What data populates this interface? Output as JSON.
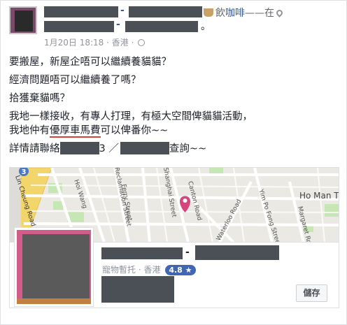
{
  "post": {
    "name_sep": "-",
    "feeling_prefix": "飲",
    "feeling_item": "咖啡",
    "feeling_at": "——在",
    "subtitle_sep": "-",
    "subtitle_end": "。",
    "timestamp": "1月20日 18:18",
    "location": "香港",
    "dot": "·",
    "body": {
      "line1": "要搬屋，新屋企唔可以繼續養貓貓？",
      "line2": "經濟問題唔可以繼續養了嗎？",
      "line3": "拾獲棄貓嗎？",
      "line4": "我地一樣接收，有專人打理，有極大空間俾貓貓活動，",
      "line5_a": "我地仲有",
      "line5_b": "優厚車馬費",
      "line5_c": "可以俾番你~~",
      "line6_a": "詳情請聯絡",
      "line6_b": "3 ／",
      "line6_c": "查詢~~"
    }
  },
  "map": {
    "labels": {
      "l1": "Lin Cheung Road",
      "l2": "Hoi Wang",
      "l3": "Ferry Street",
      "l4": "Shanghai Street",
      "l5": "Reclamation Street",
      "l6": "Canton Road",
      "l7": "Waterloo Road",
      "l8": "Yim Po Fong Street",
      "l9": "Margaret Road",
      "l10": "Ho Man T",
      "l11": "3"
    },
    "colors": {
      "pin": "#d4467c",
      "highway": "#f2d56b",
      "park": "#c6e6b4",
      "water": "#aadaff"
    }
  },
  "place": {
    "name_sep": "-",
    "category": "寵物暫托",
    "location": "香港",
    "dot": "·",
    "rating": "4.8 ★",
    "save_label": "儲存"
  }
}
